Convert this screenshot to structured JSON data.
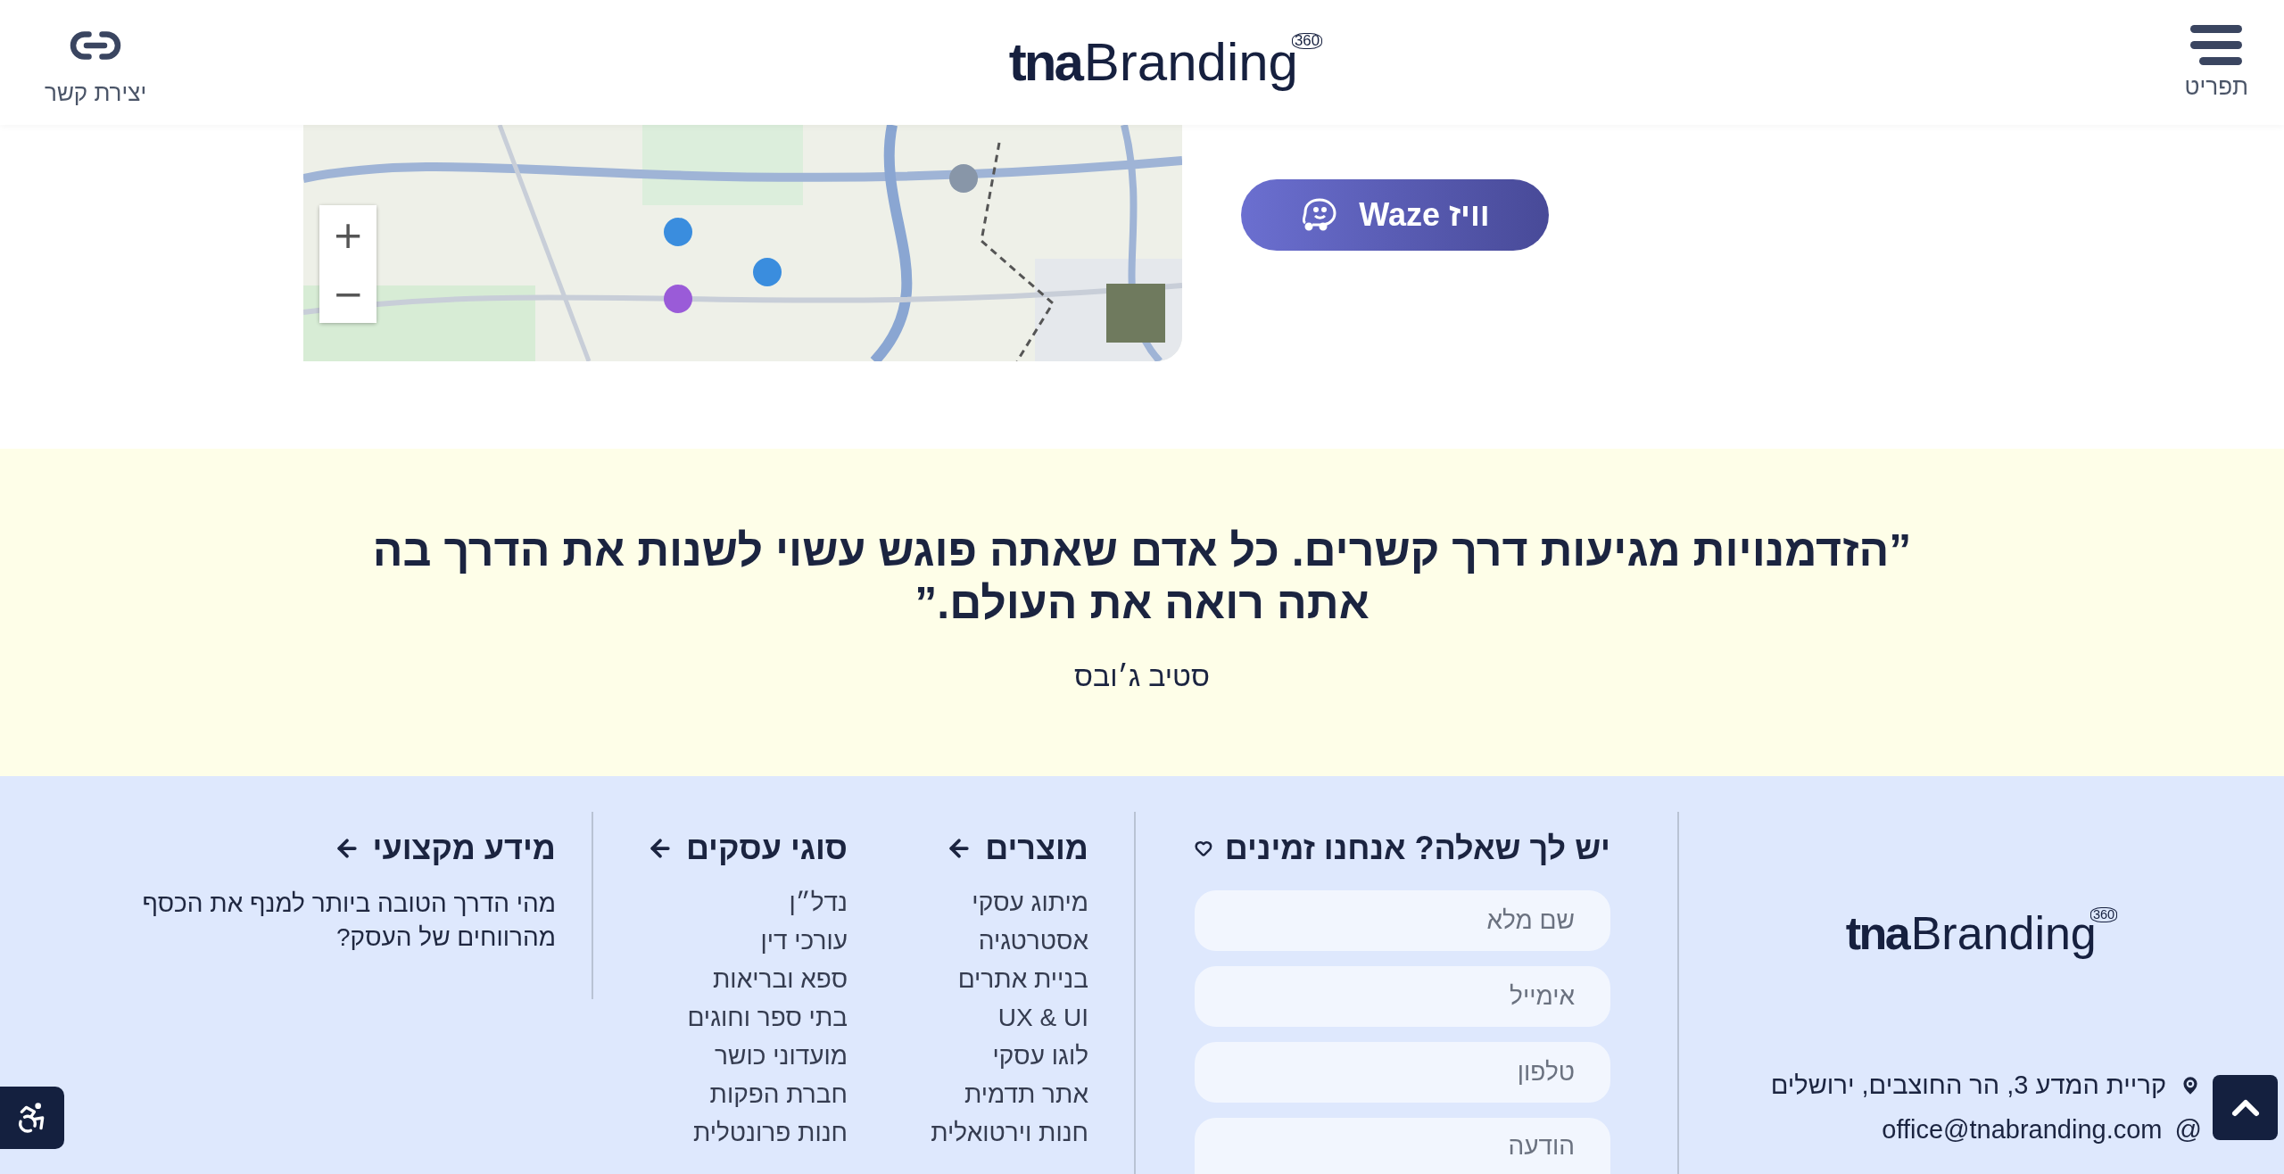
{
  "header": {
    "menu_label": "תפריט",
    "contact_label": "יצירת קשר",
    "logo": {
      "bold": "tna",
      "light": "Branding",
      "badge": "360"
    }
  },
  "map": {
    "kind": "picture",
    "zoom_in": "+",
    "zoom_out": "−"
  },
  "waze_button": {
    "label": "וויז Waze"
  },
  "quote": {
    "text": "”הזדמנויות מגיעות דרך קשרים. כל אדם שאתה פוגש עשוי לשנות את הדרך בה אתה רואה את העולם.”",
    "author": "סטיב ג׳ובס"
  },
  "footer": {
    "logo": {
      "bold": "tna",
      "light": "Branding",
      "badge": "360"
    },
    "contact": {
      "address": "קריית המדע 3, הר החוצבים, ירושלים",
      "email_symbol": "@",
      "email": "office@tnabranding.com"
    },
    "form": {
      "title": "יש לך שאלה? אנחנו זמינים",
      "fields": [
        {
          "kind": "input",
          "placeholder": "שם מלא"
        },
        {
          "kind": "input",
          "placeholder": "אימייל"
        },
        {
          "kind": "input",
          "placeholder": "טלפון"
        },
        {
          "kind": "textarea",
          "placeholder": "הודעה"
        }
      ]
    },
    "products": {
      "title": "מוצרים",
      "items": [
        "מיתוג עסקי",
        "אסטרטגיה",
        "בניית אתרים",
        "UX & UI",
        "לוגו עסקי",
        "אתר תדמית",
        "חנות וירטואלית"
      ]
    },
    "business_types": {
      "title": "סוגי עסקים",
      "items": [
        "נדל״ן",
        "עורכי דין",
        "ספא ובריאות",
        "בתי ספר וחוגים",
        "מועדוני כושר",
        "חברת הפקות",
        "חנות פרונטלית"
      ]
    },
    "professional": {
      "title": "מידע מקצועי",
      "articles": [
        "מהי הדרך הטובה ביותר למנף את הכסף מהרווחים של העסק?"
      ]
    }
  }
}
